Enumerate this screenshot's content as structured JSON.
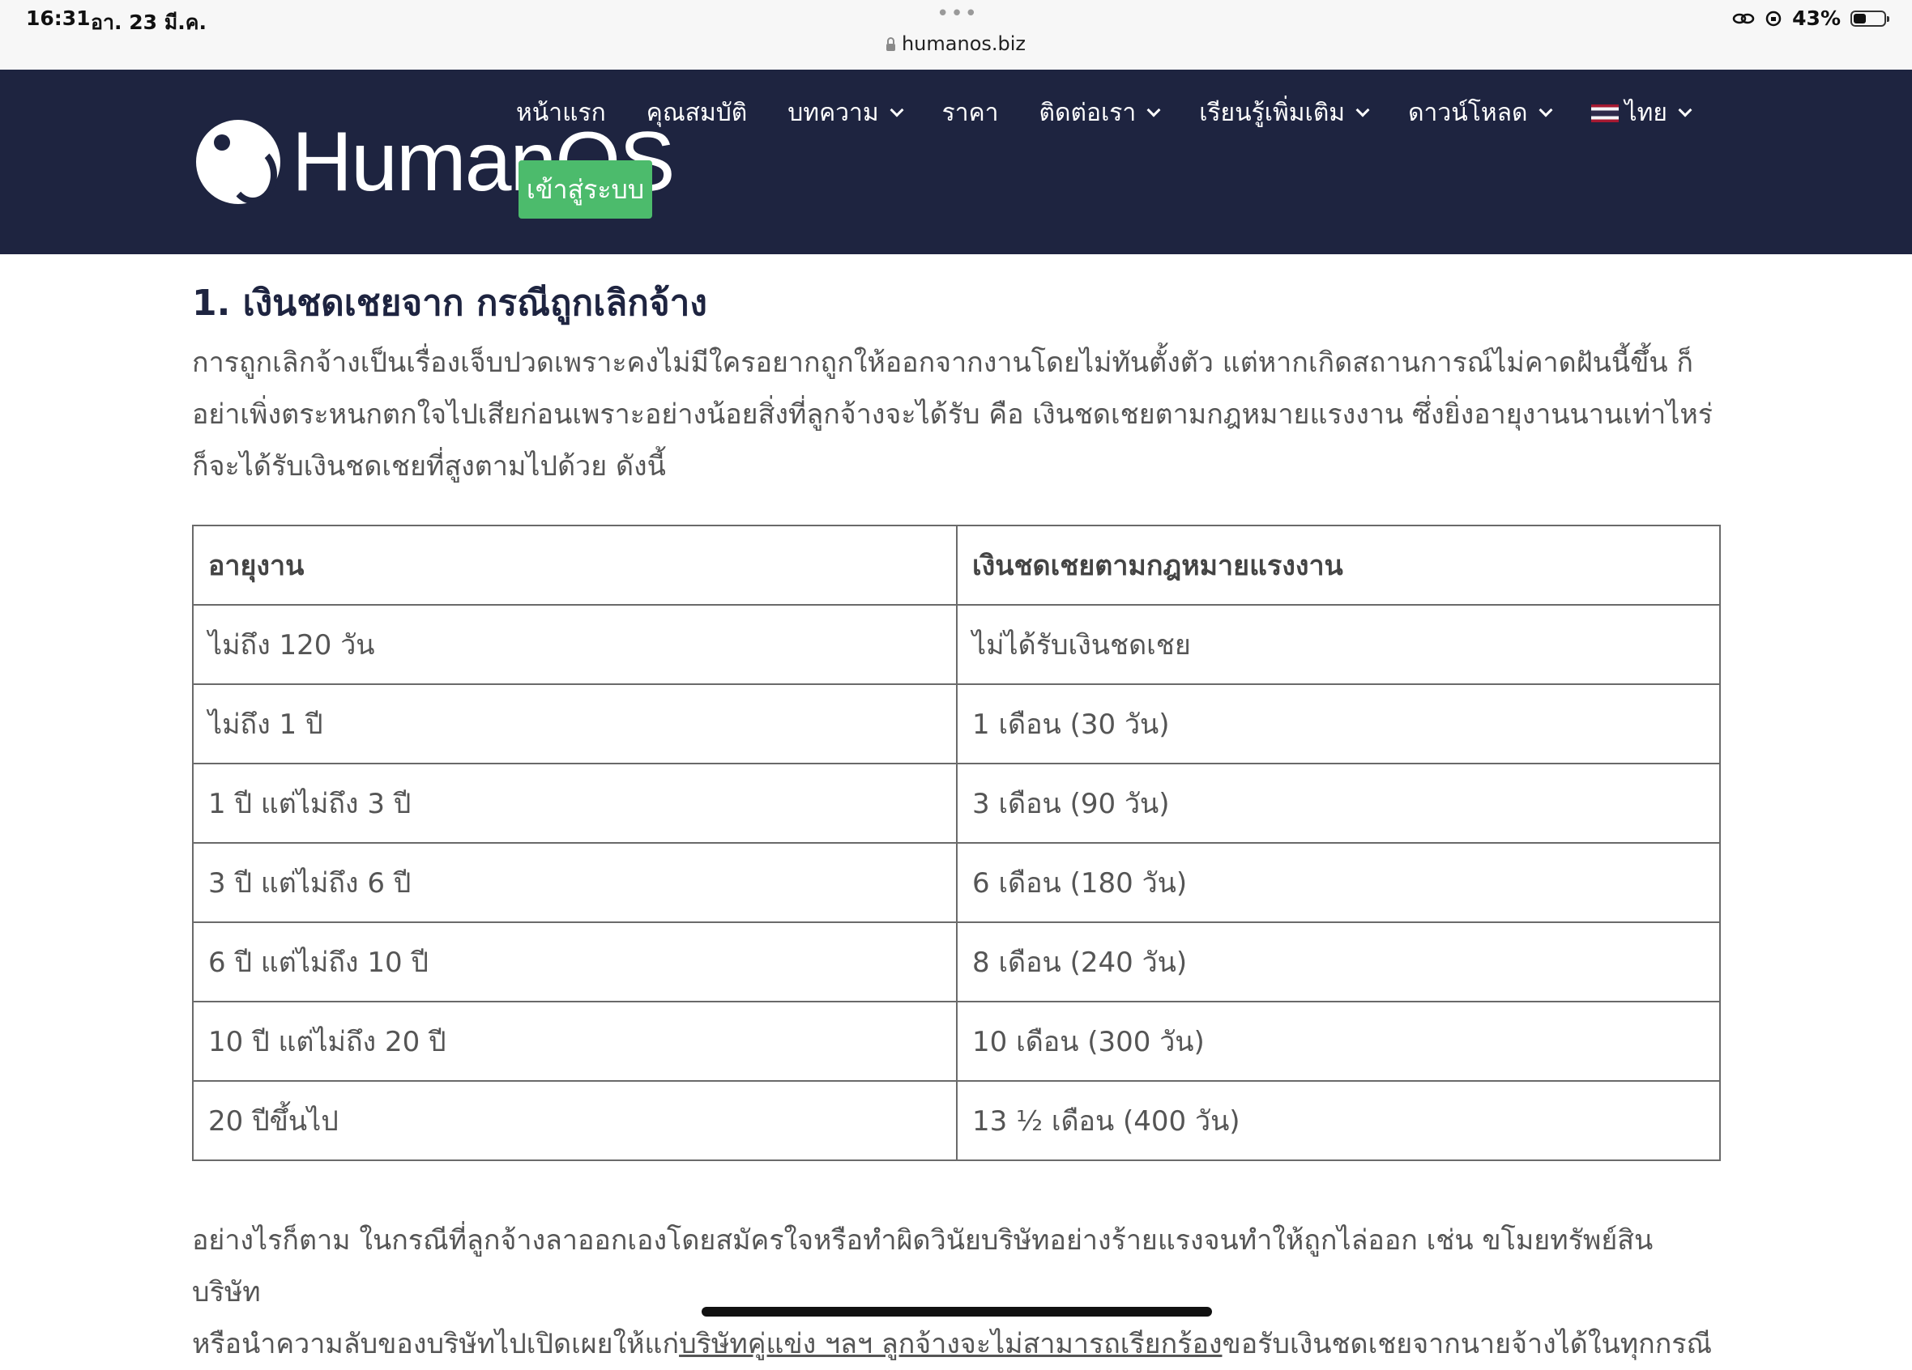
{
  "status_bar": {
    "time": "16:31",
    "date": "อา. 23 มี.ค.",
    "url": "humanos.biz",
    "battery": "43%",
    "battery_level": 0.43
  },
  "header": {
    "logo_text": "HumanOS",
    "login_label": "เข้าสู่ระบบ",
    "nav": [
      {
        "label": "หน้าแรก",
        "dropdown": false
      },
      {
        "label": "คุณสมบัติ",
        "dropdown": false
      },
      {
        "label": "บทความ",
        "dropdown": true
      },
      {
        "label": "ราคา",
        "dropdown": false
      },
      {
        "label": "ติดต่อเรา",
        "dropdown": true
      },
      {
        "label": "เรียนรู้เพิ่มเติม",
        "dropdown": true
      },
      {
        "label": "ดาวน์โหลด",
        "dropdown": true
      },
      {
        "label": "ไทย",
        "dropdown": true
      }
    ],
    "colors": {
      "background": "#1e2440",
      "login_button": "#4cbb6c"
    }
  },
  "article": {
    "heading": "1. เงินชดเชยจาก กรณีถูกเลิกจ้าง",
    "intro": "การถูกเลิกจ้างเป็นเรื่องเจ็บปวดเพราะคงไม่มีใครอยากถูกให้ออกจากงานโดยไม่ทันตั้งตัว แต่หากเกิดสถานการณ์ไม่คาดฝันนี้ขึ้น ก็อย่าเพิ่งตระหนกตกใจไปเสียก่อนเพราะอย่างน้อยสิ่งที่ลูกจ้างจะได้รับ คือ เงินชดเชยตามกฎหมายแรงงาน ซึ่งยิ่งอายุงานนานเท่าไหร่ ก็จะได้รับเงินชดเชยที่สูงตามไปด้วย ดังนี้",
    "table": {
      "headers": [
        "อายุงาน",
        "เงินชดเชยตามกฎหมายแรงงาน"
      ],
      "rows": [
        [
          "ไม่ถึง 120 วัน",
          "ไม่ได้รับเงินชดเชย"
        ],
        [
          "ไม่ถึง 1 ปี",
          "1 เดือน (30 วัน)"
        ],
        [
          "1 ปี แต่ไม่ถึง 3 ปี",
          "3 เดือน (90 วัน)"
        ],
        [
          "3 ปี แต่ไม่ถึง 6 ปี",
          "6 เดือน (180 วัน)"
        ],
        [
          "6 ปี แต่ไม่ถึง 10 ปี",
          "8 เดือน (240 วัน)"
        ],
        [
          "10 ปี แต่ไม่ถึง 20 ปี",
          "10 เดือน (300 วัน)"
        ],
        [
          "20 ปีขึ้นไป",
          "13 ½ เดือน (400 วัน)"
        ]
      ]
    },
    "outro_line1": "อย่างไรก็ตาม ในกรณีที่ลูกจ้างลาออกเองโดยสมัครใจหรือทำผิดวินัยบริษัทอย่างร้ายแรงจนทำให้ถูกไล่ออก เช่น ขโมยทรัพย์สินบริษัท",
    "outro_line2_a": "หรือนำความลับของบริษัทไปเปิดเผยให้แก่",
    "outro_line2_link": "บริษัทคู่แข่ง ฯลฯ ลูกจ้างจะไม่สามารถเรียกร้อง",
    "outro_line2_b": "ขอรับเงินชดเชยจากนายจ้างได้ในทุกกรณี"
  }
}
